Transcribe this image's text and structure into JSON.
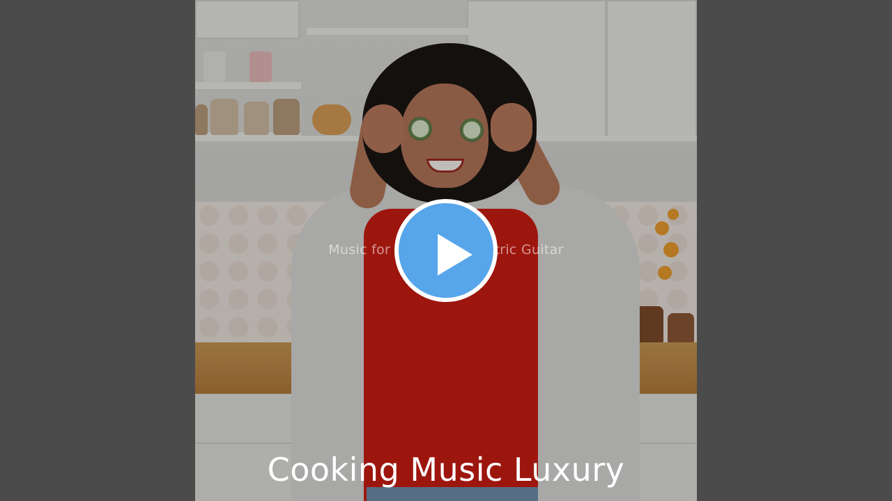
{
  "video": {
    "subtitle": "Music for Dinner                                  ed Electric Guitar",
    "title": "Cooking Music Luxury",
    "play_icon": "play-icon"
  },
  "colors": {
    "side_panels": "#4b4b4b",
    "play_button_fill": "#57a5ea",
    "play_button_ring": "#ffffff",
    "title_text": "#ffffff"
  }
}
